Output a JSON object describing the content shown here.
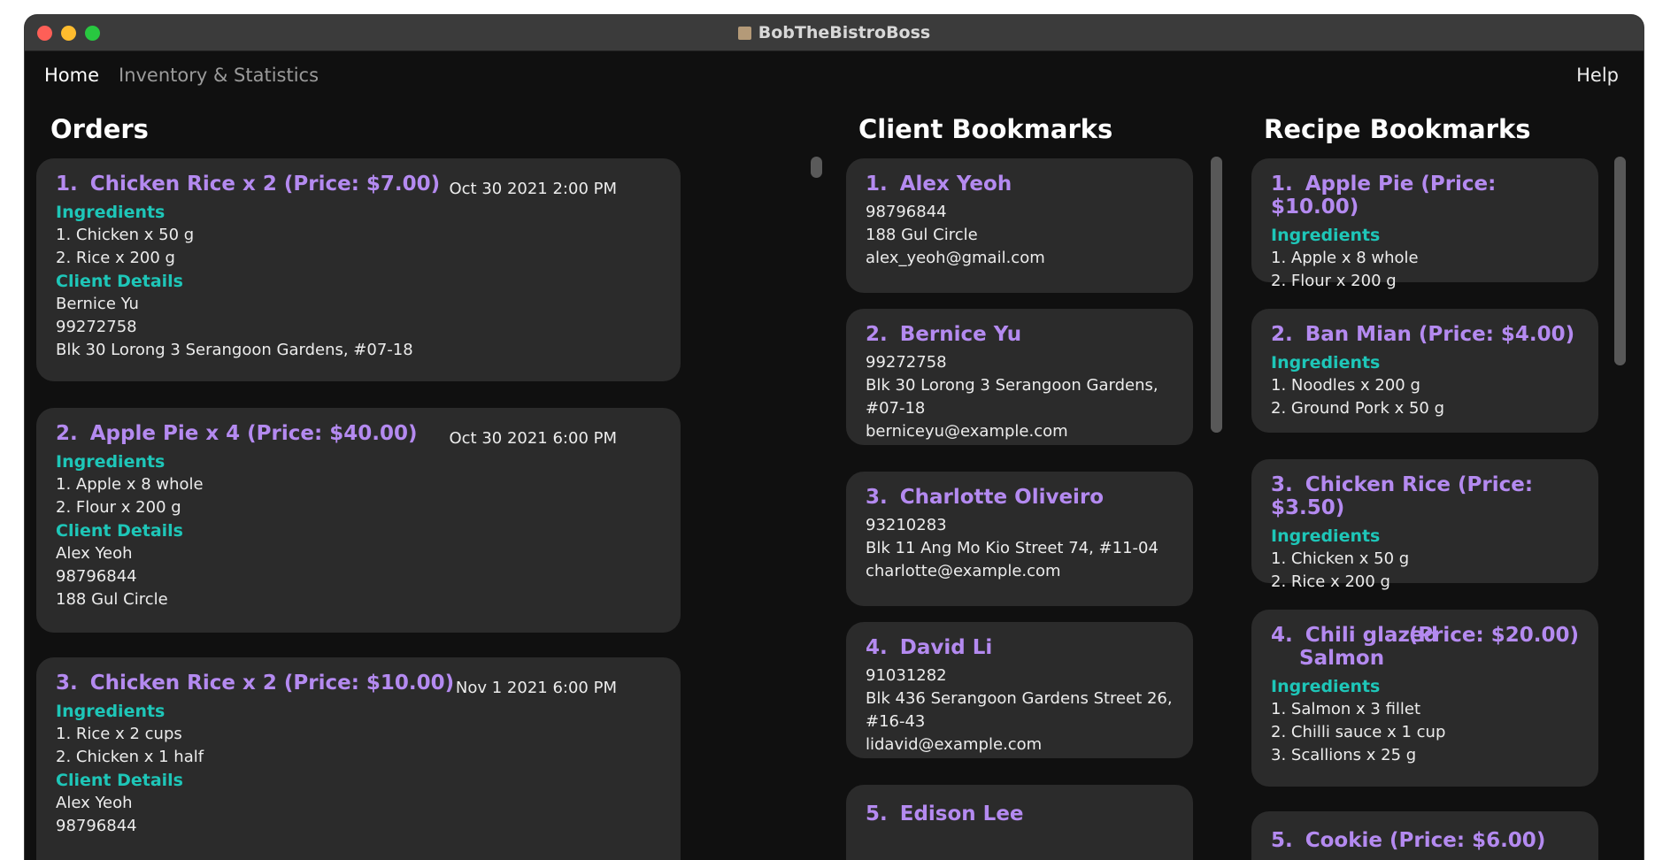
{
  "window": {
    "title": "BobTheBistroBoss"
  },
  "menu": {
    "home": "Home",
    "inventory": "Inventory & Statistics",
    "help": "Help"
  },
  "orders": {
    "title": "Orders",
    "items": [
      {
        "num": "1.",
        "title": "Chicken Rice x 2 (Price: $7.00)",
        "datetime": "Oct 30 2021 2:00 PM",
        "ingredients_label": "Ingredients",
        "ingredients": [
          "1. Chicken x 50 g",
          "2. Rice x 200 g"
        ],
        "client_label": "Client Details",
        "client": [
          "Bernice Yu",
          "99272758",
          "Blk 30 Lorong 3 Serangoon Gardens, #07-18"
        ]
      },
      {
        "num": "2.",
        "title": "Apple Pie x 4 (Price: $40.00)",
        "datetime": "Oct 30 2021 6:00 PM",
        "ingredients_label": "Ingredients",
        "ingredients": [
          "1. Apple x 8 whole",
          "2. Flour x 200 g"
        ],
        "client_label": "Client Details",
        "client": [
          "Alex Yeoh",
          "98796844",
          "188 Gul Circle"
        ]
      },
      {
        "num": "3.",
        "title": "Chicken Rice x 2 (Price: $10.00)",
        "datetime": "Nov 1 2021 6:00 PM",
        "ingredients_label": "Ingredients",
        "ingredients": [
          "1. Rice x 2 cups",
          "2. Chicken x 1 half"
        ],
        "client_label": "Client Details",
        "client": [
          "Alex Yeoh",
          "98796844"
        ]
      }
    ]
  },
  "clients": {
    "title": "Client Bookmarks",
    "items": [
      {
        "num": "1.",
        "name": "Alex Yeoh",
        "lines": [
          "98796844",
          "188 Gul Circle",
          "alex_yeoh@gmail.com"
        ]
      },
      {
        "num": "2.",
        "name": "Bernice Yu",
        "lines": [
          "99272758",
          "Blk 30 Lorong 3 Serangoon Gardens,",
          "#07-18",
          "berniceyu@example.com"
        ]
      },
      {
        "num": "3.",
        "name": "Charlotte Oliveiro",
        "lines": [
          "93210283",
          "Blk 11 Ang Mo Kio Street 74, #11-04",
          "charlotte@example.com"
        ]
      },
      {
        "num": "4.",
        "name": "David Li",
        "lines": [
          "91031282",
          "Blk 436 Serangoon Gardens Street 26,",
          "#16-43",
          "lidavid@example.com"
        ]
      },
      {
        "num": "5.",
        "name": "Edison Lee",
        "lines": []
      }
    ]
  },
  "recipes": {
    "title": "Recipe Bookmarks",
    "items": [
      {
        "num": "1.",
        "name": "Apple Pie",
        "price": "(Price: $10.00)",
        "ingredients_label": "Ingredients",
        "ingredients": [
          "1. Apple x 8 whole",
          "2. Flour x 200 g"
        ]
      },
      {
        "num": "2.",
        "name": "Ban Mian",
        "price": "(Price: $4.00)",
        "ingredients_label": "Ingredients",
        "ingredients": [
          "1. Noodles x 200 g",
          "2. Ground Pork x 50 g"
        ]
      },
      {
        "num": "3.",
        "name": "Chicken Rice",
        "price": "(Price: $3.50)",
        "ingredients_label": "Ingredients",
        "ingredients": [
          "1. Chicken x 50 g",
          "2. Rice x 200 g"
        ]
      },
      {
        "num": "4.",
        "name": "Chili glazed",
        "name2": "Salmon",
        "price": "(Price: $20.00)",
        "ingredients_label": "Ingredients",
        "ingredients": [
          "1. Salmon x 3 fillet",
          "2. Chilli sauce x 1 cup",
          "3. Scallions x 25 g"
        ]
      },
      {
        "num": "5.",
        "name": "Cookie",
        "price": "(Price: $6.00)",
        "ingredients_label": "",
        "ingredients": []
      }
    ]
  },
  "colors": {
    "accent": "#b48af0",
    "subheading": "#1ec6b8",
    "card": "#2b2b2b",
    "background": "#101010"
  }
}
